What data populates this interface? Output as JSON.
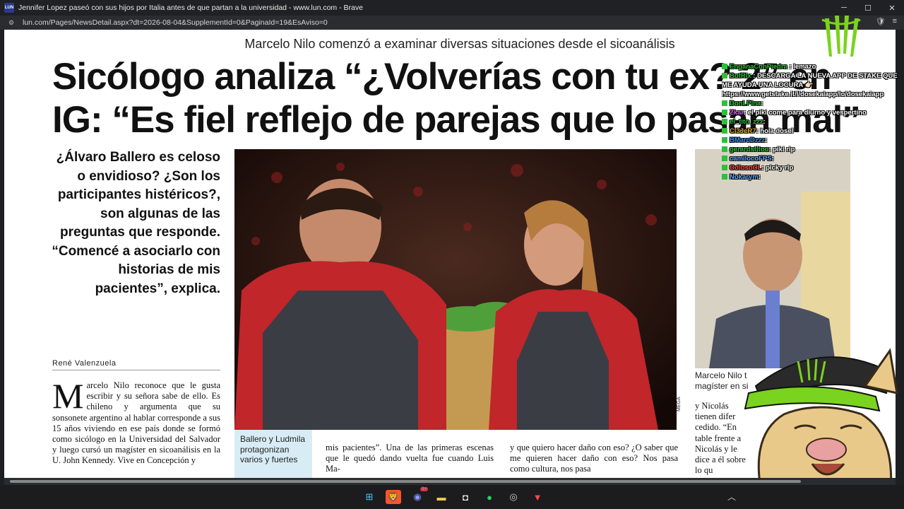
{
  "browser": {
    "favicon_text": "LUN",
    "window_title": "Jennifer Lopez paseó con sus hijos por Italia antes de que partan a la universidad - www.lun.com - Brave",
    "url": "lun.com/Pages/NewsDetail.aspx?dt=2026-08-04&SupplementId=0&PaginaId=19&EsAviso=0",
    "minimize": "─",
    "maximize": "☐",
    "close": "✕"
  },
  "article": {
    "kicker": "Marcelo Nilo comenzó a examinar diversas situaciones desde el sicoanálisis",
    "headline_line1": "Sicólogo analiza “¿Volverías con tu ex? 2” en",
    "headline_line2": "IG: “Es fiel reflejo de parejas que lo pasan mal”",
    "lead": "¿Álvaro Ballero es celoso o envidioso? ¿Son los participantes histéricos?, son algunas de las preguntas que responde. “Comencé a asociarlo con historias de mis pacientes”, explica.",
    "byline": "René Valenzuela",
    "dropcap": "M",
    "body_col1": "arcelo Nilo reconoce que le gusta escribir y su señora sabe de ello. Es chileno y argumenta que su sonsonete argentino al hablar corresponde a sus 15 años viviendo en ese país donde se formó como sicólogo en la Universidad del Salvador y luego cursó un magíster en sicoanálisis en la U. John Kennedy. Vive en Concepción y",
    "photo_credit": "MEGA",
    "caption": "Ballero y Ludmila protagonizan varios y fuertes",
    "body_col2": "mis pacientes”. Una de las primeras escenas que le quedó dando vuelta fue cuando Luis Ma-",
    "body_col3": "y que quiero hacer daño con eso? ¿O saber que me quieren hacer daño con eso? Nos pasa como cultura, nos pasa",
    "inset_caption": "Marcelo Nilo t magíster en si",
    "right_col": "y Nicolás tienen difer cedido. “En table frente a Nicolás y le dice a él sobre lo qu"
  },
  "chat": [
    {
      "user": "EnganaConPiedra",
      "text": ": lemazo",
      "color": "#2fbf3a"
    },
    {
      "user": "BotRix",
      "text": ": DESCARGA LA NUEVA APP DE STAKE QUE ME AYUDA UNA LOCURA 👉🏻 https://www.getstake.it/l/dosekaiapp/lo/dosekaiapp",
      "color": "#2fbf3a"
    },
    {
      "user": "DonLPina",
      "text": ":",
      "color": "#2fbf3a"
    },
    {
      "user": "Zkar",
      "text": ": el piki come para diurno y vespertino",
      "color": "#d45cf0"
    },
    {
      "user": "el_tito_zzz",
      "text": ":",
      "color": "#2fbf3a"
    },
    {
      "user": "Cl3JeR7",
      "text": ": hola dosel",
      "color": "#e0a92b"
    },
    {
      "user": "BMarcDzzz",
      "text": ":",
      "color": "#3a8fff"
    },
    {
      "user": "gerardstitoo",
      "text": ": piki rip",
      "color": "#2fbf3a"
    },
    {
      "user": "camilocoFPS",
      "text": ":",
      "color": "#5fa8ff"
    },
    {
      "user": "OdiosoCL",
      "text": ": picky rip",
      "color": "#ff4d4d"
    },
    {
      "user": "Nokarym",
      "text": ":",
      "color": "#5fa8ff"
    }
  ],
  "taskbar": {
    "icons": [
      "windows-start-icon",
      "brave-browser-icon",
      "discord-icon",
      "file-explorer-icon",
      "media-icon",
      "spotify-icon",
      "chrome-icon",
      "valorant-icon"
    ],
    "notification_count": "9+"
  },
  "colors": {
    "chat_badge": "#2fbf3a",
    "monster_green": "#7ad31f",
    "caption_bg": "#d8ecf5"
  }
}
